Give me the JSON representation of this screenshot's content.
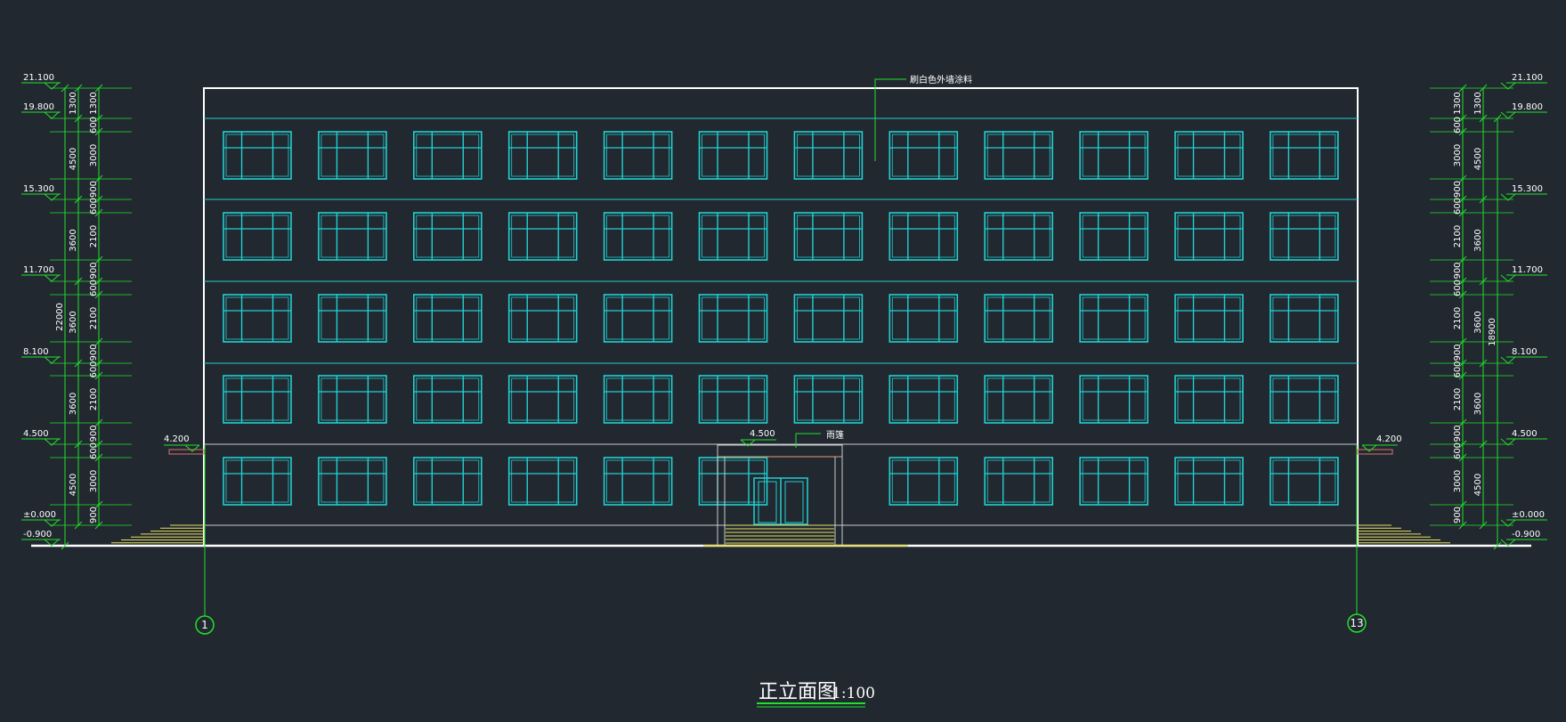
{
  "title": "正立面图",
  "scale": "1:100",
  "annotations": {
    "wall_finish": "刷白色外墙涂料",
    "canopy": "雨篷",
    "canopy_level": "4.500"
  },
  "grid_axes": [
    "1",
    "13"
  ],
  "elevations_left": [
    "21.100",
    "19.800",
    "15.300",
    "11.700",
    "8.100",
    "4.500",
    "±0.000",
    "-0.900"
  ],
  "elevations_right": [
    "21.100",
    "19.800",
    "15.300",
    "11.700",
    "8.100",
    "4.500",
    "±0.000",
    "-0.900"
  ],
  "side_level_left": "4.200",
  "side_level_right": "4.200",
  "dims_left_inner": [
    "1300",
    "600",
    "3000",
    "900",
    "600",
    "2100",
    "900",
    "600",
    "2100",
    "900",
    "600",
    "2100",
    "900",
    "600",
    "3000",
    "900"
  ],
  "dims_left_outer": [
    "1300",
    "4500",
    "3600",
    "3600",
    "3600",
    "4500"
  ],
  "dims_left_total": "22000",
  "dims_right_inner": [
    "1300",
    "600",
    "3000",
    "900",
    "600",
    "2100",
    "900",
    "600",
    "2100",
    "900",
    "600",
    "2100",
    "900",
    "600",
    "3000",
    "900"
  ],
  "dims_right_outer": [
    "1300",
    "4500",
    "3600",
    "3600",
    "3600",
    "4500"
  ],
  "dims_right_total": "18900",
  "colors": {
    "background": "#212830",
    "window": "#22d0d0",
    "dimension": "#22e02a",
    "outline": "#ffffff",
    "stairs": "#e8e060"
  }
}
